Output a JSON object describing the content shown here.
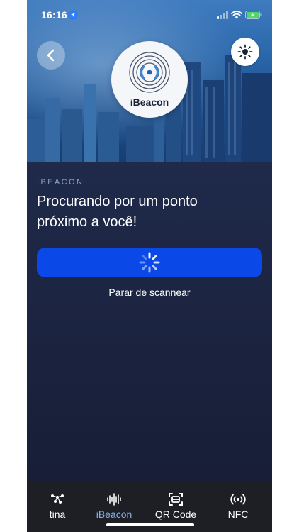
{
  "status_bar": {
    "time": "16:16"
  },
  "hero": {
    "logo_text": "iBeacon"
  },
  "content": {
    "section_label": "IBEACON",
    "heading": "Procurando por um ponto próximo a você!",
    "stop_link": "Parar de scannear"
  },
  "tabbar": {
    "items": [
      {
        "label": "tina",
        "icon": "network-icon",
        "active": false
      },
      {
        "label": "iBeacon",
        "icon": "waveform-icon",
        "active": true
      },
      {
        "label": "QR Code",
        "icon": "qr-scan-icon",
        "active": false
      },
      {
        "label": "NFC",
        "icon": "nfc-icon",
        "active": false
      }
    ]
  },
  "colors": {
    "accent": "#0a49e8",
    "active_tab": "#7fb2f5",
    "background": "#1e2847"
  }
}
